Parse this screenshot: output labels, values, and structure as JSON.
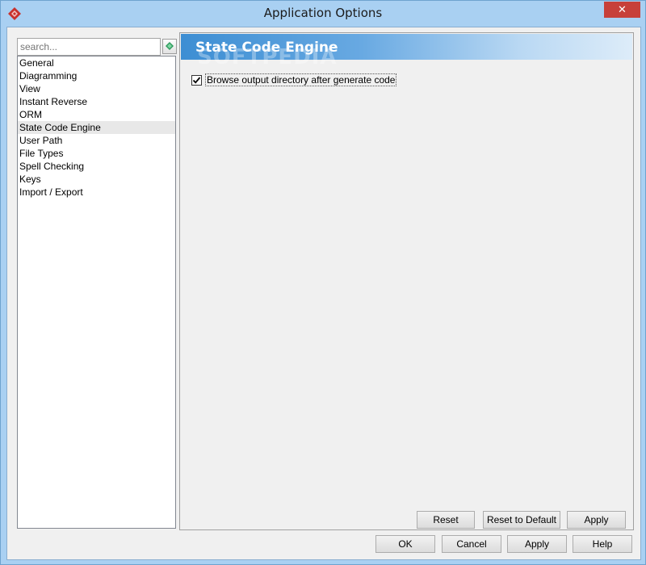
{
  "window": {
    "title": "Application Options",
    "close_label": "✕"
  },
  "search": {
    "placeholder": "search..."
  },
  "nav": {
    "items": [
      {
        "label": "General"
      },
      {
        "label": "Diagramming"
      },
      {
        "label": "View"
      },
      {
        "label": "Instant Reverse"
      },
      {
        "label": "ORM"
      },
      {
        "label": "State Code Engine"
      },
      {
        "label": "User Path"
      },
      {
        "label": "File Types"
      },
      {
        "label": "Spell Checking"
      },
      {
        "label": "Keys"
      },
      {
        "label": "Import / Export"
      }
    ],
    "selected_index": 5
  },
  "panel": {
    "title": "State Code Engine",
    "watermark": "SOFTPEDIA",
    "options": [
      {
        "label": "Browse output directory after generate code",
        "checked": true
      }
    ],
    "buttons": {
      "reset": "Reset",
      "reset_default": "Reset to Default",
      "apply": "Apply"
    }
  },
  "footer": {
    "ok": "OK",
    "cancel": "Cancel",
    "apply": "Apply",
    "help": "Help"
  },
  "colors": {
    "header_gradient_start": "#3d8ed3",
    "close_button": "#c7403a",
    "window_frame": "#a9d0f2"
  }
}
